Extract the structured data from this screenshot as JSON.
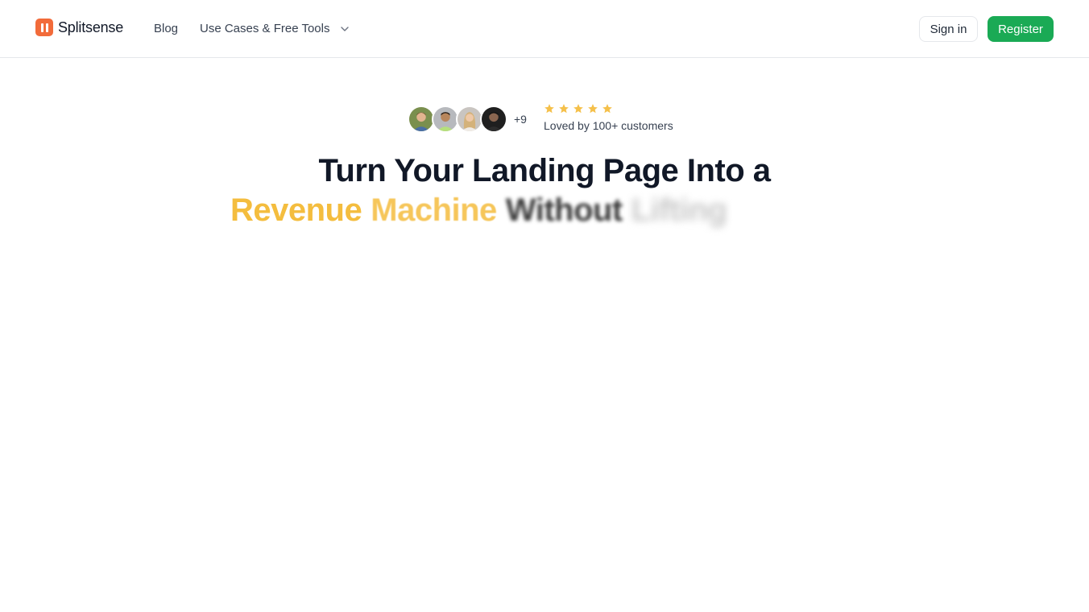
{
  "nav": {
    "brand_name": "Splitsense",
    "links": {
      "blog": "Blog",
      "use_cases": "Use Cases & Free Tools"
    },
    "sign_in_label": "Sign in",
    "register_label": "Register"
  },
  "hero": {
    "social_proof": {
      "extra_count": "+9",
      "rating_stars": 5,
      "loved_text": "Loved by 100+ customers"
    },
    "title_line1": "Turn Your Landing Page Into a",
    "title_line2_words": [
      "Revenue",
      "Machine",
      "Without",
      "Lifting"
    ]
  },
  "colors": {
    "brand_logo": "#f26b3a",
    "register_button": "#1aaa55",
    "highlight_gold": "#f4bd3e",
    "star_gold": "#f5c04a"
  },
  "icons": {
    "logo": "splitsense-logo-icon",
    "dropdown": "chevron-down-icon",
    "star": "star-icon"
  }
}
